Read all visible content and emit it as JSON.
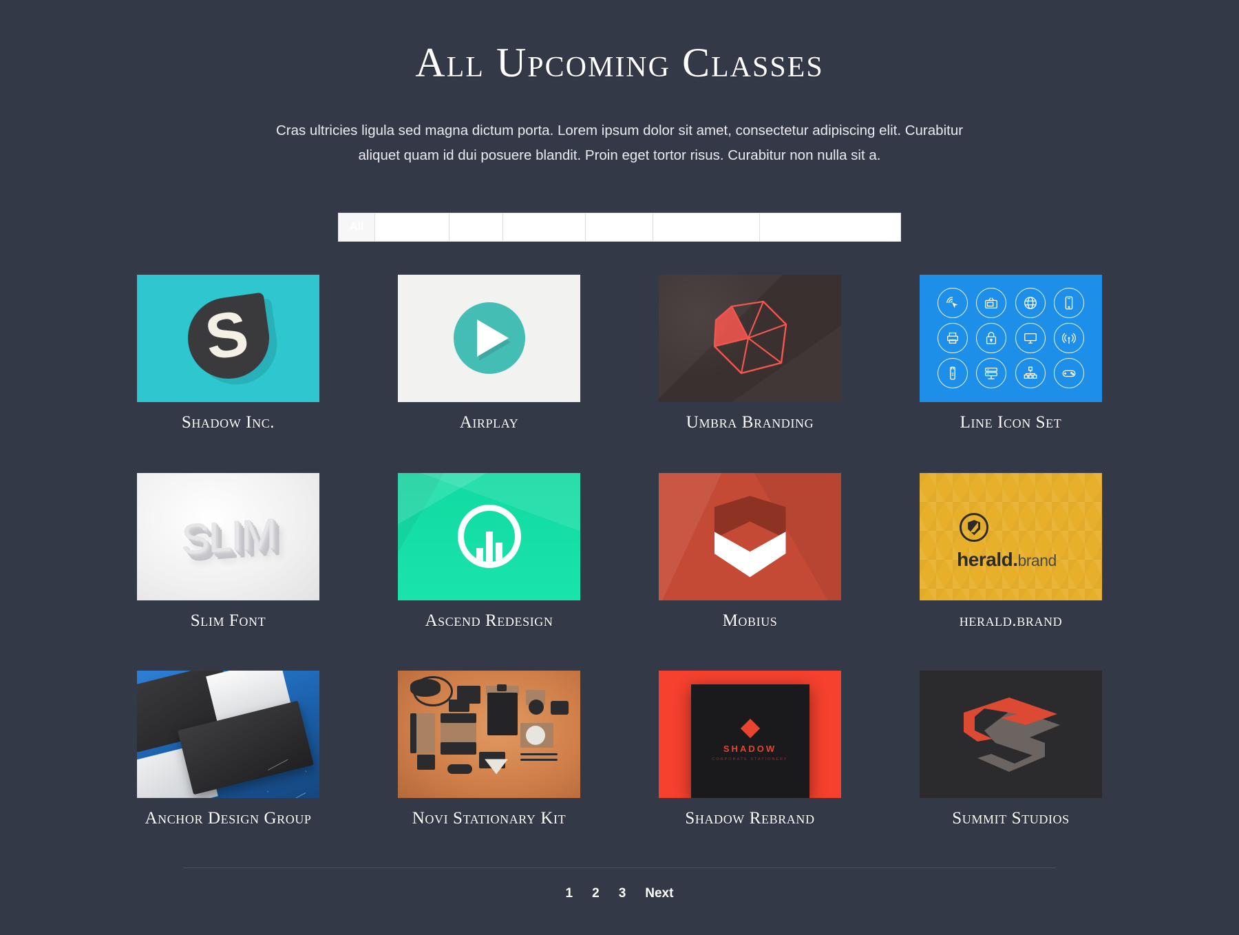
{
  "header": {
    "title": "All Upcoming Classes",
    "description": "Cras ultricies ligula sed magna dictum porta. Lorem ipsum dolor sit amet, consectetur adipiscing elit. Curabitur aliquet quam id dui posuere blandit. Proin eget tortor risus. Curabitur non nulla sit a."
  },
  "filters": {
    "items": [
      {
        "label": "All",
        "active": true
      },
      {
        "label": "",
        "active": false
      },
      {
        "label": "",
        "active": false
      },
      {
        "label": "",
        "active": false
      },
      {
        "label": "",
        "active": false
      },
      {
        "label": "",
        "active": false
      },
      {
        "label": "",
        "active": false
      }
    ]
  },
  "grid": {
    "items": [
      {
        "title": "Shadow Inc.",
        "art": "shadow-inc",
        "bg": "#2ec6cf",
        "letter": "S"
      },
      {
        "title": "Airplay",
        "art": "airplay",
        "bg": "#f2f2f0"
      },
      {
        "title": "Umbra Branding",
        "art": "umbra",
        "bg": "#3a302f"
      },
      {
        "title": "Line Icon Set",
        "art": "line-icons",
        "bg": "#1e8fe8"
      },
      {
        "title": "Slim Font",
        "art": "slim",
        "bg": "#f2f2f3",
        "word": "SLIM"
      },
      {
        "title": "Ascend Redesign",
        "art": "ascend",
        "bg": "#12e3a8"
      },
      {
        "title": "Mobius",
        "art": "mobius",
        "bg": "#c44a36"
      },
      {
        "title": "herald.brand",
        "art": "herald",
        "bg": "#e8b02a",
        "word": "herald.",
        "word2": "brand"
      },
      {
        "title": "Anchor Design Group",
        "art": "anchor",
        "bg": "#1f69b8"
      },
      {
        "title": "Novi Stationary Kit",
        "art": "novi",
        "bg": "#d5874f"
      },
      {
        "title": "Shadow Rebrand",
        "art": "rebrand",
        "bg": "#f5412d",
        "word": "SHADOW",
        "word2": "CORPORATE STATIONERY"
      },
      {
        "title": "Summit Studios",
        "art": "summit",
        "bg": "#2b2b2d"
      }
    ]
  },
  "line_icons": [
    "cursor-click-icon",
    "television-icon",
    "globe-icon",
    "smartphone-icon",
    "printer-icon",
    "lock-icon",
    "monitor-icon",
    "wifi-signal-icon",
    "usb-drive-icon",
    "server-icon",
    "sitemap-icon",
    "gamepad-icon"
  ],
  "pagination": {
    "pages": [
      "1",
      "2",
      "3"
    ],
    "next_label": "Next"
  },
  "colors": {
    "background": "#333947",
    "text": "#ffffff",
    "divider": "#4b5160"
  }
}
